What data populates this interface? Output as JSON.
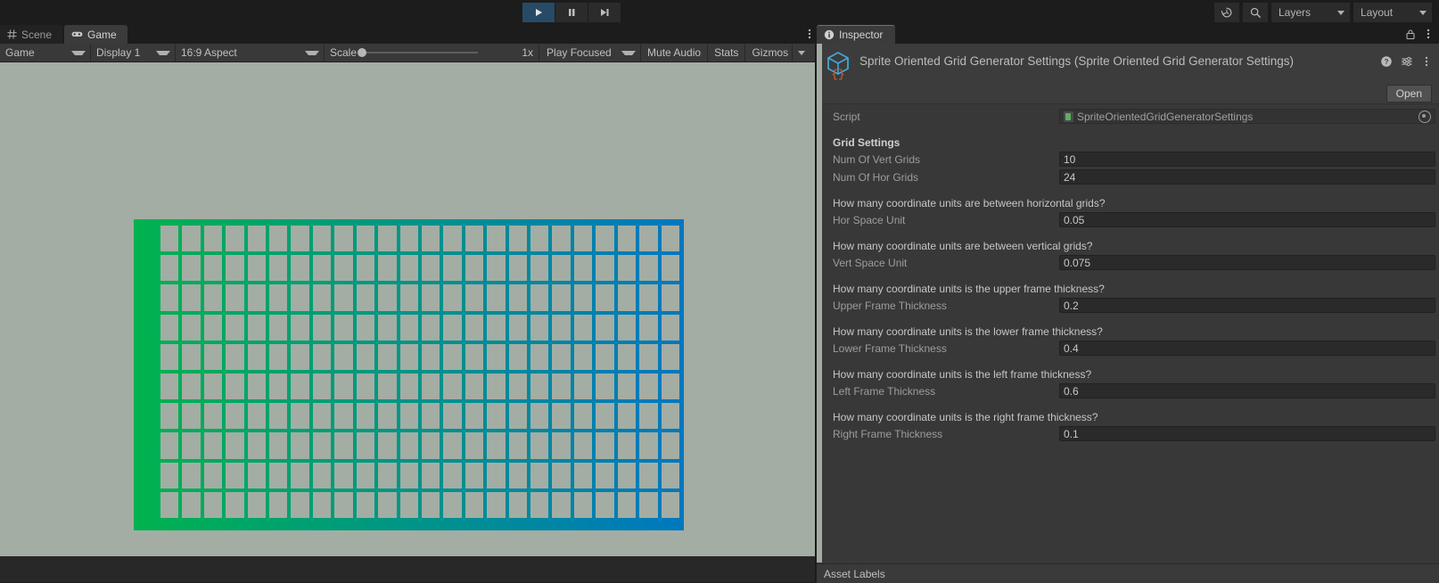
{
  "toolbar": {
    "play_icon": "play-icon",
    "pause_icon": "pause-icon",
    "step_icon": "step-icon",
    "history_icon": "history-icon",
    "search_icon": "search-icon",
    "layers_label": "Layers",
    "layout_label": "Layout",
    "accent_color": "#274b66"
  },
  "game_panel": {
    "tabs": [
      {
        "label": "Scene",
        "icon": "grid-icon",
        "active": false
      },
      {
        "label": "Game",
        "icon": "gamepad-icon",
        "active": true
      }
    ],
    "view_toolbar": {
      "view_mode": "Game",
      "display": "Display 1",
      "aspect": "16:9 Aspect",
      "scale_label": "Scale",
      "scale_value": "1x",
      "play_mode": "Play Focused",
      "mute_audio": "Mute Audio",
      "stats": "Stats",
      "gizmos": "Gizmos"
    },
    "background_color": "#a3ada3",
    "sprite": {
      "name": "sprite-oriented-grid",
      "gradient_start": "#00b24e",
      "gradient_end": "#0077c0",
      "rows": 10,
      "cols": 24,
      "cell_color": "#a3ada3"
    }
  },
  "inspector": {
    "tab_label": "Inspector",
    "tab_icon": "info-icon",
    "lock_icon": "lock-icon",
    "kebab_icon": "kebab-icon",
    "object_icon": "scriptable-object-icon",
    "title": "Sprite Oriented Grid Generator Settings (Sprite Oriented Grid Generator Settings)",
    "header_icons": {
      "help": "help-icon",
      "preset": "preset-icon",
      "menu": "kebab-icon"
    },
    "open_button": "Open",
    "script_row": {
      "label": "Script",
      "value": "SpriteOrientedGridGeneratorSettings",
      "icon": "cs-script-icon",
      "picker_icon": "object-picker-icon"
    },
    "section_title": "Grid Settings",
    "fields": [
      {
        "label": "Num Of Vert Grids",
        "value": "10",
        "help": null
      },
      {
        "label": "Num Of Hor Grids",
        "value": "24",
        "help": null
      },
      {
        "label": "Hor Space Unit",
        "value": "0.05",
        "help": "How many coordinate units are between horizontal grids?"
      },
      {
        "label": "Vert Space Unit",
        "value": "0.075",
        "help": "How many coordinate units are between vertical grids?"
      },
      {
        "label": "Upper Frame Thickness",
        "value": "0.2",
        "help": "How many coordinate units is the upper frame thickness?"
      },
      {
        "label": "Lower Frame Thickness",
        "value": "0.4",
        "help": "How many coordinate units is the lower frame thickness?"
      },
      {
        "label": "Left Frame Thickness",
        "value": "0.6",
        "help": "How many coordinate units is the left frame thickness?"
      },
      {
        "label": "Right Frame Thickness",
        "value": "0.1",
        "help": "How many coordinate units is the right frame thickness?"
      }
    ],
    "asset_labels": "Asset Labels"
  }
}
